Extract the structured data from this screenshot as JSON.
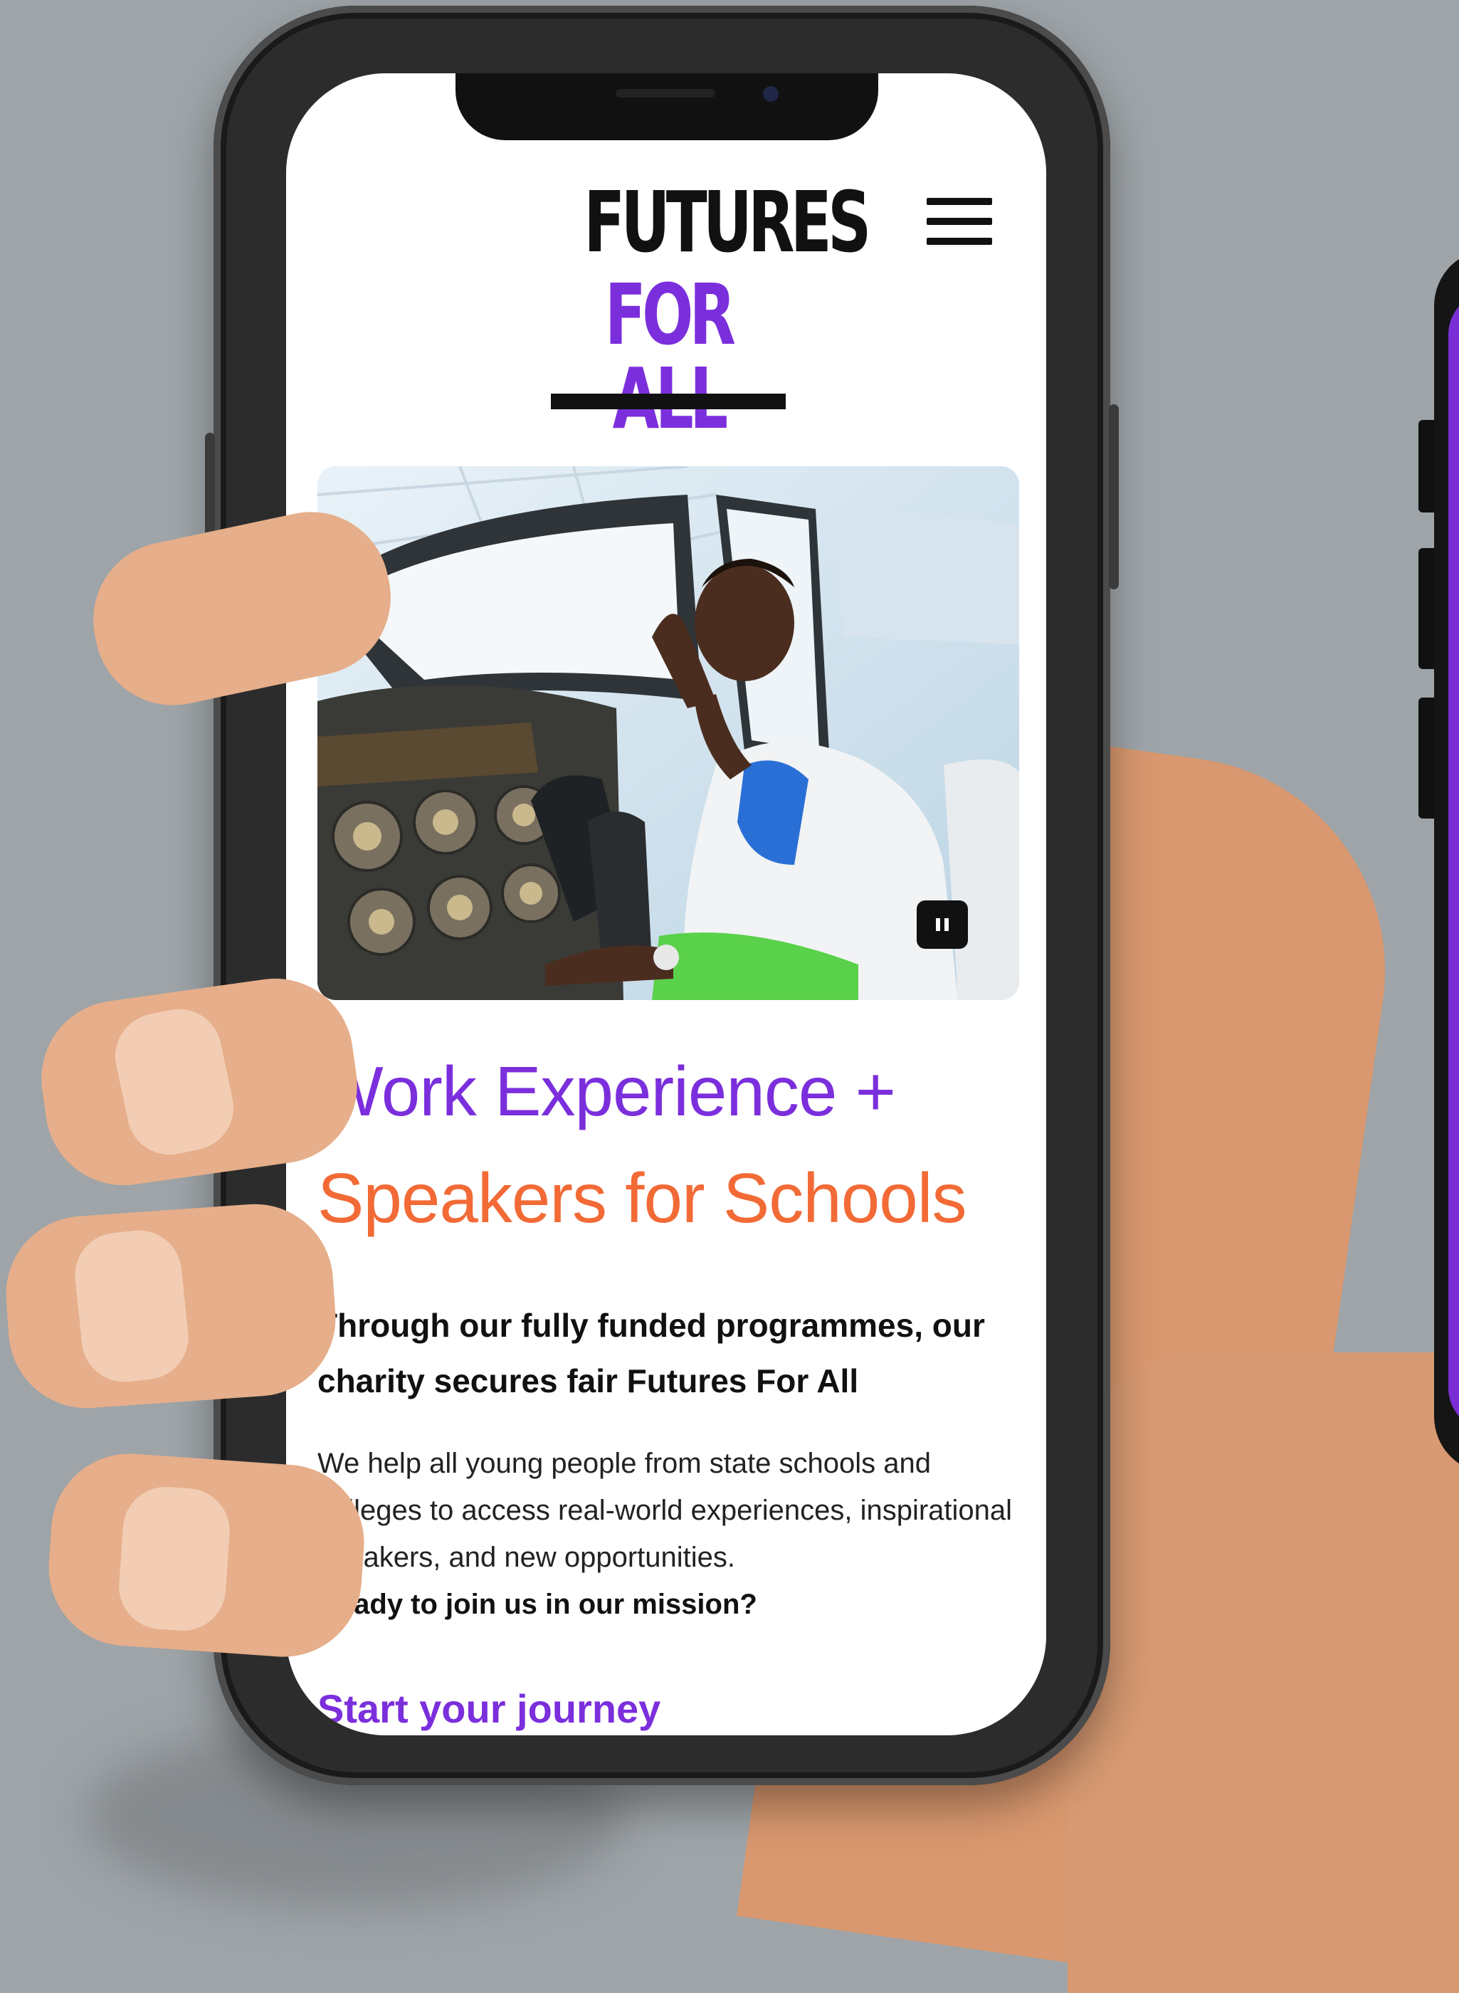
{
  "colors": {
    "brand_purple": "#7b2fdc",
    "accent_orange": "#f26a36",
    "text_dark": "#111111",
    "background": "#9ea4a8"
  },
  "header": {
    "logo_line1": "FUTURES",
    "logo_line2": "FOR ALL",
    "menu_icon": "hamburger-menu-icon"
  },
  "hero": {
    "image_alt": "Young person smiling in an aircraft cockpit",
    "pause_icon": "pause-icon"
  },
  "headline": {
    "part1": "Work Experience +",
    "part2": "Speakers for Schools"
  },
  "subheading": "Through our fully funded programmes, our charity secures fair Futures For All",
  "body": {
    "text": "We help all young people from state schools and colleges to access real-world experiences, inspirational speakers, and new opportunities.",
    "strong": "Ready to join us in our mission?"
  },
  "cta": {
    "label": "Start your journey"
  }
}
